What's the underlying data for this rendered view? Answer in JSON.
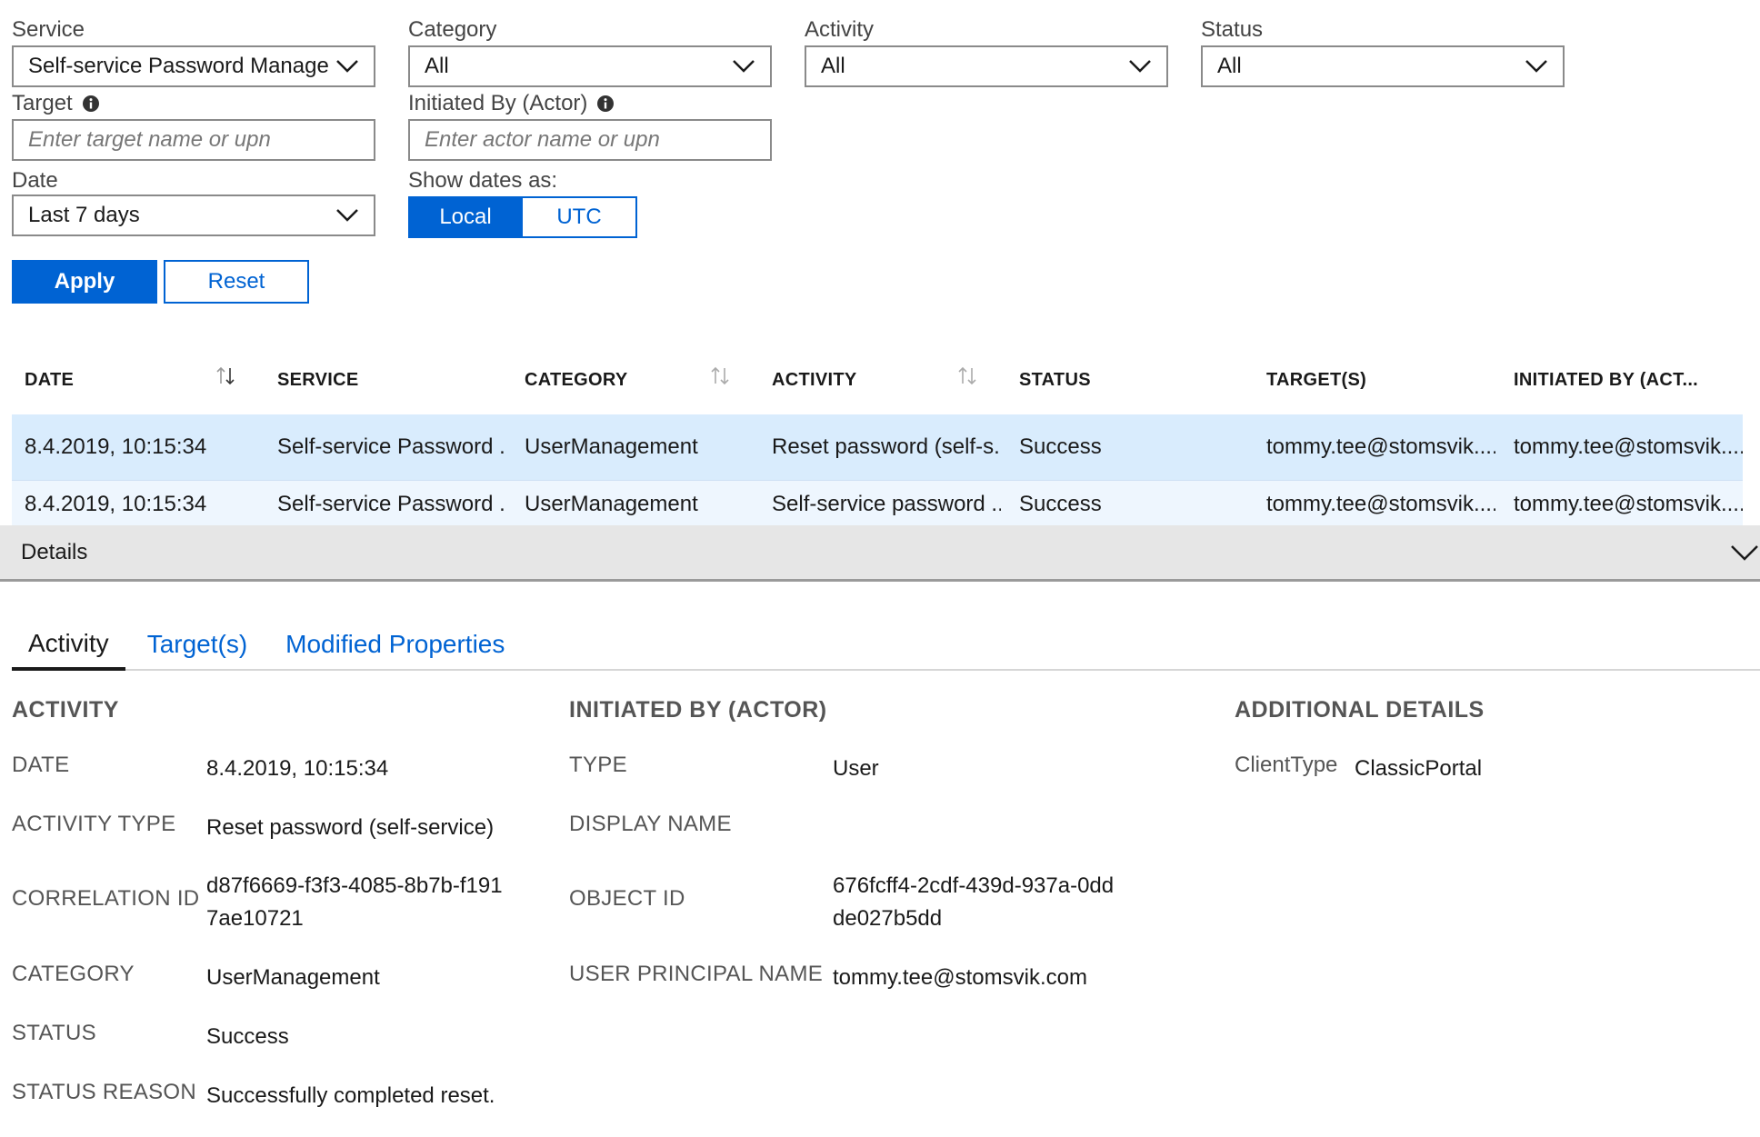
{
  "filters": {
    "service": {
      "label": "Service",
      "value": "Self-service Password Manage..."
    },
    "category": {
      "label": "Category",
      "value": "All"
    },
    "activity": {
      "label": "Activity",
      "value": "All"
    },
    "status": {
      "label": "Status",
      "value": "All"
    },
    "target": {
      "label": "Target",
      "placeholder": "Enter target name or upn",
      "value": ""
    },
    "actor": {
      "label": "Initiated By (Actor)",
      "placeholder": "Enter actor name or upn",
      "value": ""
    },
    "date": {
      "label": "Date",
      "value": "Last 7 days"
    },
    "show_dates": {
      "label": "Show dates as:",
      "options": [
        "Local",
        "UTC"
      ],
      "selected": "Local"
    },
    "apply_label": "Apply",
    "reset_label": "Reset"
  },
  "table": {
    "columns": [
      "DATE",
      "SERVICE",
      "CATEGORY",
      "ACTIVITY",
      "STATUS",
      "TARGET(S)",
      "INITIATED BY (ACT..."
    ],
    "rows": [
      [
        "8.4.2019, 10:15:34",
        "Self-service Password ...",
        "UserManagement",
        "Reset password (self-s...",
        "Success",
        "tommy.tee@stomsvik....",
        "tommy.tee@stomsvik...."
      ],
      [
        "8.4.2019, 10:15:34",
        "Self-service Password ...",
        "UserManagement",
        "Self-service password ...",
        "Success",
        "tommy.tee@stomsvik....",
        "tommy.tee@stomsvik...."
      ]
    ]
  },
  "details": {
    "title": "Details",
    "tabs": [
      "Activity",
      "Target(s)",
      "Modified Properties"
    ],
    "active_tab": "Activity",
    "activity_section": {
      "heading": "ACTIVITY",
      "fields": [
        {
          "key": "DATE",
          "value": "8.4.2019, 10:15:34"
        },
        {
          "key": "ACTIVITY TYPE",
          "value": "Reset password (self-service)"
        },
        {
          "key": "CORRELATION ID",
          "value": "d87f6669-f3f3-4085-8b7b-f1917ae10721"
        },
        {
          "key": "CATEGORY",
          "value": "UserManagement"
        },
        {
          "key": "STATUS",
          "value": "Success"
        },
        {
          "key": "STATUS REASON",
          "value": "Successfully completed reset."
        }
      ]
    },
    "actor_section": {
      "heading": "INITIATED BY (ACTOR)",
      "fields": [
        {
          "key": "TYPE",
          "value": "User"
        },
        {
          "key": "DISPLAY NAME",
          "value": ""
        },
        {
          "key": "OBJECT ID",
          "value": "676fcff4-2cdf-439d-937a-0ddde027b5dd"
        },
        {
          "key": "USER PRINCIPAL NAME",
          "value": "tommy.tee@stomsvik.com"
        }
      ]
    },
    "additional_section": {
      "heading": "ADDITIONAL DETAILS",
      "fields": [
        {
          "key": "ClientType",
          "value": "ClassicPortal"
        }
      ]
    }
  },
  "colors": {
    "accent": "#0063d3",
    "selected_row": "#d9ecfd",
    "details_bar": "#e6e6e6"
  }
}
